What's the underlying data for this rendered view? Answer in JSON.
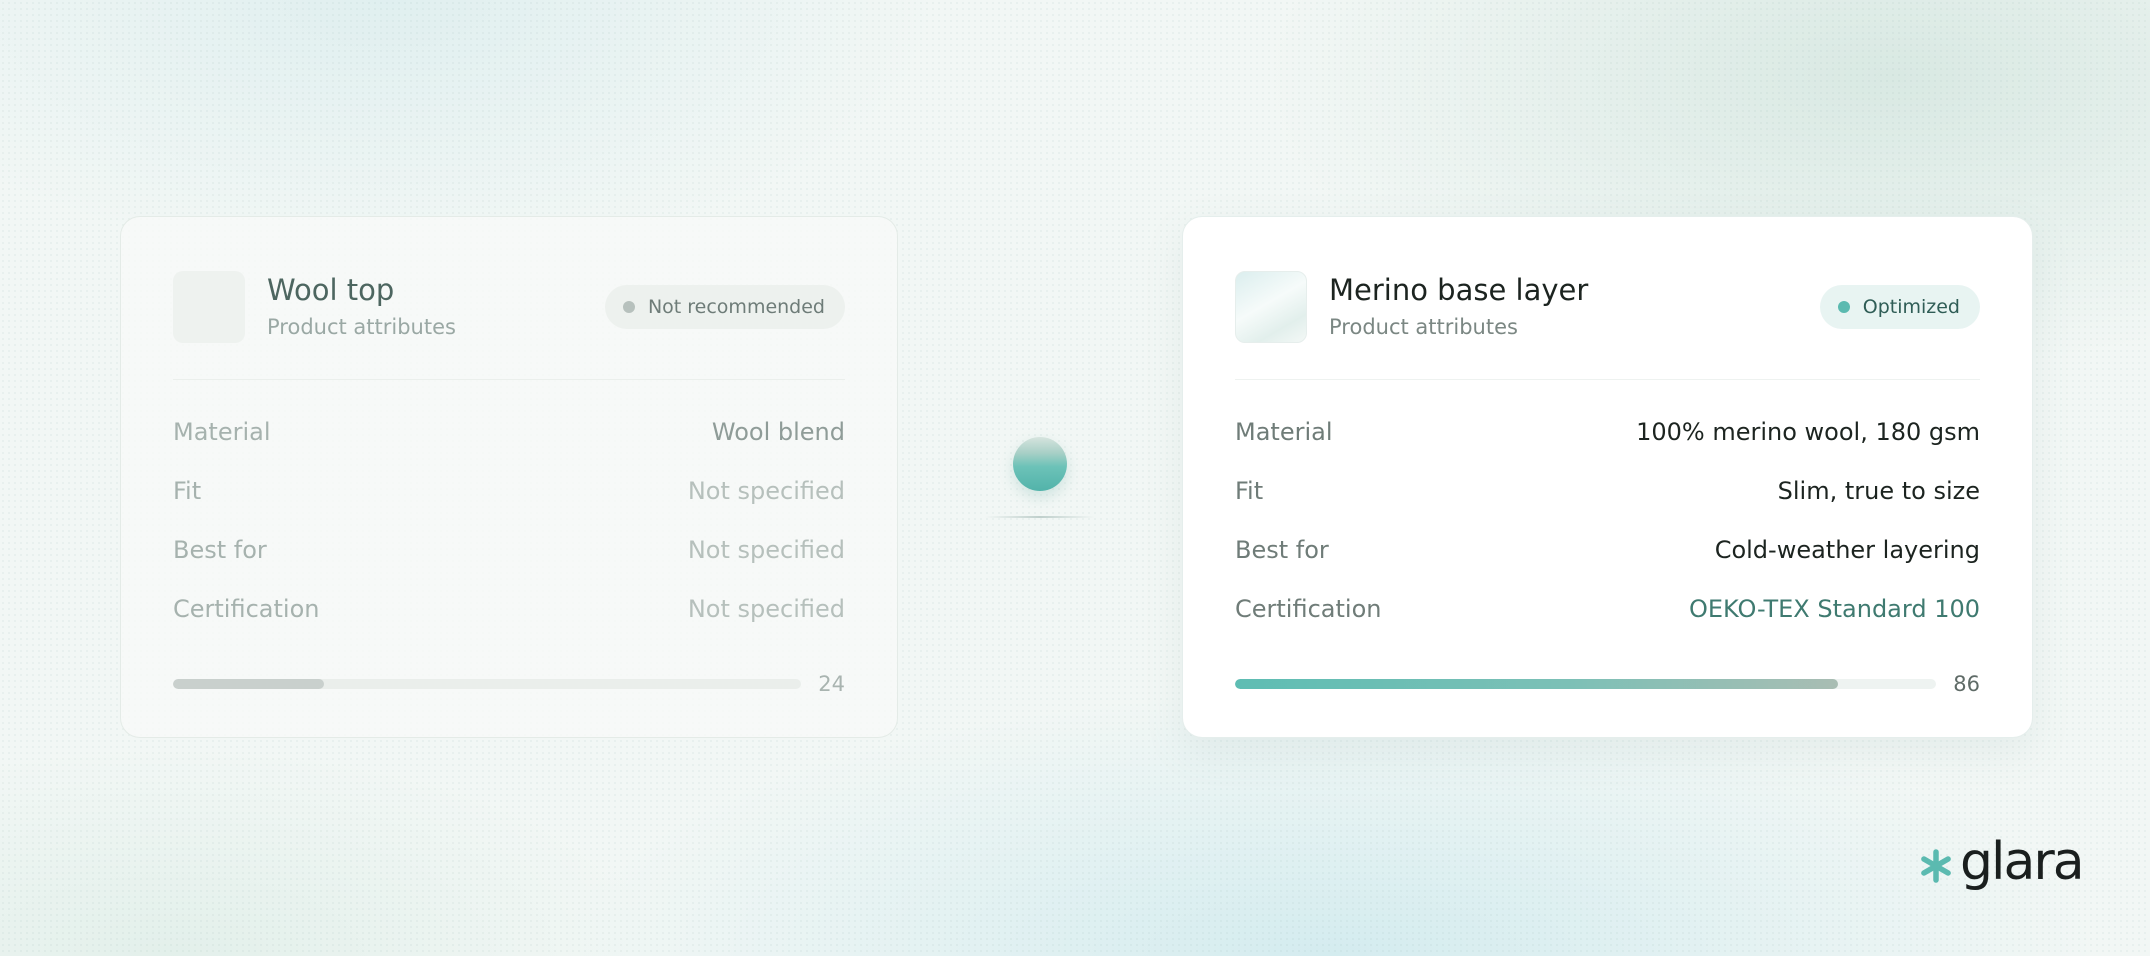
{
  "left_card": {
    "title": "Wool top",
    "subtitle": "Product attributes",
    "badge": "Not recommended",
    "attributes": [
      {
        "label": "Material",
        "value": "Wool blend"
      },
      {
        "label": "Fit",
        "value": "Not specified"
      },
      {
        "label": "Best for",
        "value": "Not specified"
      },
      {
        "label": "Certification",
        "value": "Not specified"
      }
    ],
    "score": 24
  },
  "right_card": {
    "title": "Merino base layer",
    "subtitle": "Product attributes",
    "badge": "Optimized",
    "attributes": [
      {
        "label": "Material",
        "value": "100% merino wool, 180 gsm"
      },
      {
        "label": "Fit",
        "value": "Slim, true to size"
      },
      {
        "label": "Best for",
        "value": "Cold-weather layering"
      },
      {
        "label": "Certification",
        "value": "OEKO-TEX Standard 100"
      }
    ],
    "score": 86
  },
  "brand": {
    "name": "glara",
    "icon": "asterisk-icon"
  },
  "colors": {
    "accent": "#5bbab0",
    "accent_text": "#3f7a70",
    "muted_badge_dot": "#b7c1bd"
  }
}
